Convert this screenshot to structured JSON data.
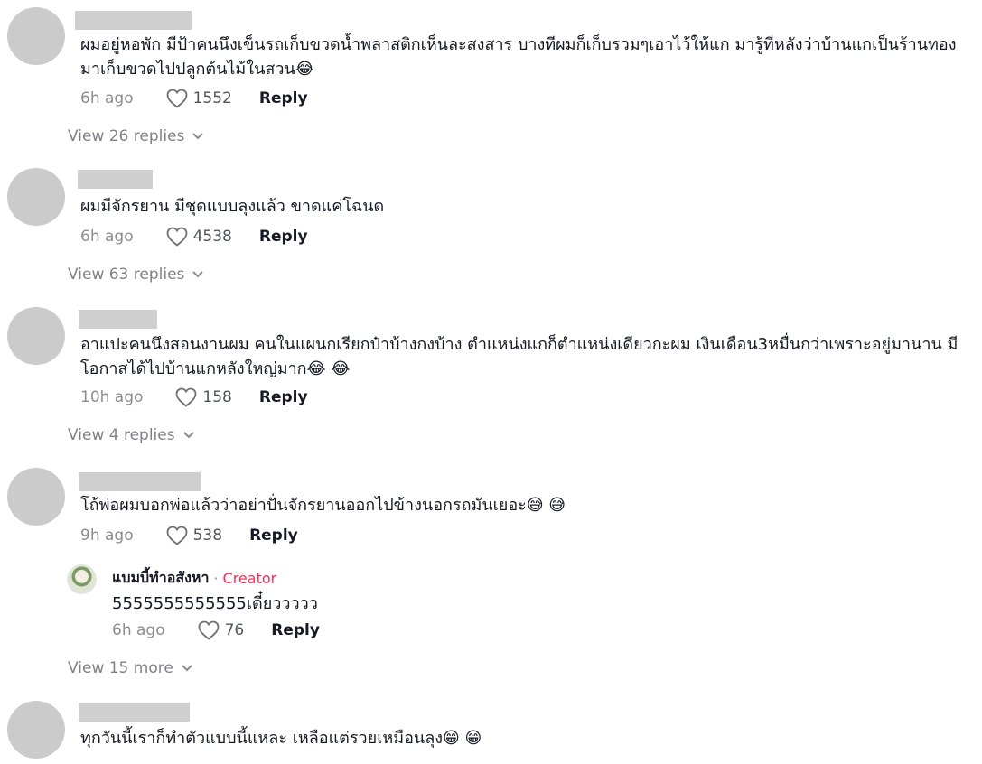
{
  "comments": [
    {
      "text": "ผมอยู่หอพัก มีป้าคนนึงเข็นรถเก็บขวดน้ำพลาสติกเห็นละสงสาร บางทีผมก็เก็บรวมๆเอาไว้ให้แก มารู้ทีหลังว่าบ้านแกเป็นร้านทอง มาเก็บขวดไปปลูกต้นไม้ในสวน😂",
      "time": "6h ago",
      "likes": "1552",
      "reply_label": "Reply",
      "view_label": "View 26 replies"
    },
    {
      "text": "ผมมีจักรยาน มีชุดแบบลุงแล้ว ขาดแค่โฉนด",
      "time": "6h ago",
      "likes": "4538",
      "reply_label": "Reply",
      "view_label": "View 63 replies"
    },
    {
      "text": "อาแปะคนนึงสอนงานผม คนในแผนกเรียกป๋าบ้างกงบ้าง ตำแหน่งแกก็ตำแหน่งเดียวกะผม เงินเดือน3หมื่นกว่าเพราะอยู่มานาน มีโอกาสได้ไปบ้านแกหลังใหญ่มาก😂 😂",
      "time": "10h ago",
      "likes": "158",
      "reply_label": "Reply",
      "view_label": "View 4 replies"
    },
    {
      "text": "โถ้พ่อผมบอกพ่อแล้วว่าอย่าปั่นจักรยานออกไปข้างนอกรถมันเยอะ😅 😅",
      "time": "9h ago",
      "likes": "538",
      "reply_label": "Reply",
      "view_label": "View 15 more",
      "sub_reply": {
        "name": "แบมบี้ทำอสังหา",
        "dot": "·",
        "badge": "Creator",
        "text": "5555555555555เดี๋ยววววว",
        "time": "6h ago",
        "likes": "76",
        "reply_label": "Reply"
      }
    },
    {
      "text": "ทุกวันนี้เราก็ทำตัวแบบนี้แหละ เหลือแต่รวยเหมือนลุง😁 😁"
    }
  ],
  "colors": {
    "creator": "#fe2c55",
    "avatar_placeholder": "#cbcbcb"
  }
}
